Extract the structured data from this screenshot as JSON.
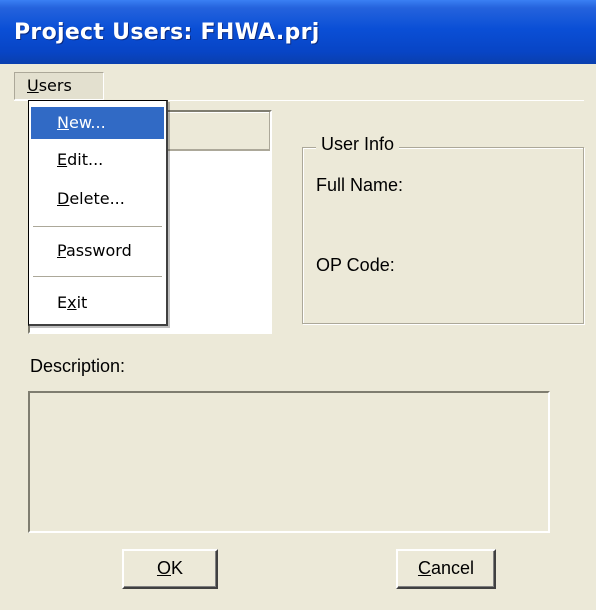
{
  "window": {
    "title": "Project Users: FHWA.prj"
  },
  "menubar": {
    "users_menu": {
      "prefix": "",
      "accel": "U",
      "rest": "sers"
    }
  },
  "dropdown": {
    "items": [
      {
        "accel": "N",
        "rest": "ew...",
        "selected": true
      },
      {
        "accel": "E",
        "rest": "dit..."
      },
      {
        "accel": "D",
        "rest": "elete..."
      },
      {
        "accel": "P",
        "rest": "assword"
      },
      {
        "prefix": "E",
        "accel": "x",
        "rest": "it"
      }
    ]
  },
  "user_info": {
    "legend": "User Info",
    "full_name_label": "Full Name:",
    "op_code_label": "OP Code:"
  },
  "description": {
    "label": "Description:",
    "value": ""
  },
  "buttons": {
    "ok": {
      "accel": "O",
      "rest": "K"
    },
    "cancel": {
      "accel": "C",
      "rest": "ancel"
    }
  },
  "colors": {
    "title_bar": "#0a4fd6",
    "face": "#ece9d8",
    "menu_highlight": "#316ac5"
  }
}
